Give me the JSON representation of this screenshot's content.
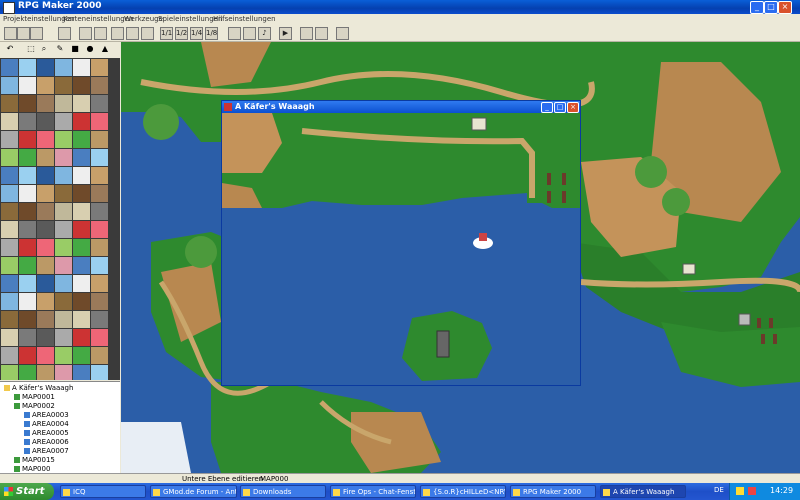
{
  "window": {
    "title": "RPG Maker 2000"
  },
  "menu": {
    "items": [
      "Projekteinstellungen",
      "Karteneinstellungen",
      "Werkzeuge",
      "Spieleinstellungen",
      "Hilfseinstellungen"
    ]
  },
  "toolbar": {
    "zoom": [
      "1/1",
      "1/2",
      "1/4",
      "1/8"
    ]
  },
  "tree": {
    "items": [
      {
        "label": "A Käfer's Waaagh",
        "level": 0,
        "type": "folder"
      },
      {
        "label": "MAP0001",
        "level": 1,
        "type": "map"
      },
      {
        "label": "MAP0002",
        "level": 1,
        "type": "map"
      },
      {
        "label": "AREA0003",
        "level": 2,
        "type": "area"
      },
      {
        "label": "AREA0004",
        "level": 2,
        "type": "area"
      },
      {
        "label": "AREA0005",
        "level": 2,
        "type": "area"
      },
      {
        "label": "AREA0006",
        "level": 2,
        "type": "area"
      },
      {
        "label": "AREA0007",
        "level": 2,
        "type": "area"
      },
      {
        "label": "MAP0015",
        "level": 1,
        "type": "map"
      },
      {
        "label": "MAP000",
        "level": 1,
        "type": "map"
      }
    ]
  },
  "statusbar": {
    "layer": "Untere Ebene editieren",
    "map": "MAP000"
  },
  "child": {
    "title": "A Käfer's Waaagh"
  },
  "taskbar": {
    "start": "Start",
    "tasks": [
      "ICQ",
      "GMod.de Forum - Ant...",
      "Downloads",
      "Fire Ops - Chat-Fenster",
      "{S.o.R}cHILLeD<NRW...",
      "RPG Maker 2000",
      "A Käfer's Waaagh"
    ],
    "lang": "DE",
    "clock": "14:29"
  },
  "colors": {
    "water": "#2b5ea8",
    "forest": "#2e8a2e",
    "sand": "#c9a66b",
    "titlebar": "#0a50d0"
  }
}
